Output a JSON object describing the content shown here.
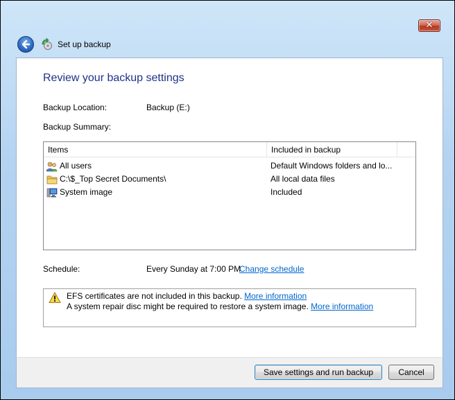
{
  "window": {
    "title": "Set up backup",
    "close_symbol": "✕"
  },
  "main": {
    "heading": "Review your backup settings",
    "backup_location_label": "Backup Location:",
    "backup_location_value": "Backup (E:)",
    "backup_summary_label": "Backup Summary:",
    "table": {
      "columns": [
        "Items",
        "Included in backup"
      ],
      "rows": [
        {
          "icon": "users-icon",
          "item": "All users",
          "included": "Default Windows folders and lo..."
        },
        {
          "icon": "folder-icon",
          "item": "C:\\$_Top Secret Documents\\",
          "included": "All local data files"
        },
        {
          "icon": "system-image-icon",
          "item": "System image",
          "included": "Included"
        }
      ]
    },
    "schedule_label": "Schedule:",
    "schedule_value": "Every Sunday at 7:00 PM",
    "change_schedule_link": "Change schedule",
    "warnings": [
      {
        "text": "EFS certificates are not included in this backup.",
        "link": "More information"
      },
      {
        "text": "A system repair disc might be required to restore a system image.",
        "link": "More information"
      }
    ]
  },
  "footer": {
    "save_button": "Save settings and run backup",
    "cancel_button": "Cancel"
  },
  "colors": {
    "heading": "#1e3287",
    "link": "#0066cc",
    "window_frame": "#b4d3f1"
  }
}
